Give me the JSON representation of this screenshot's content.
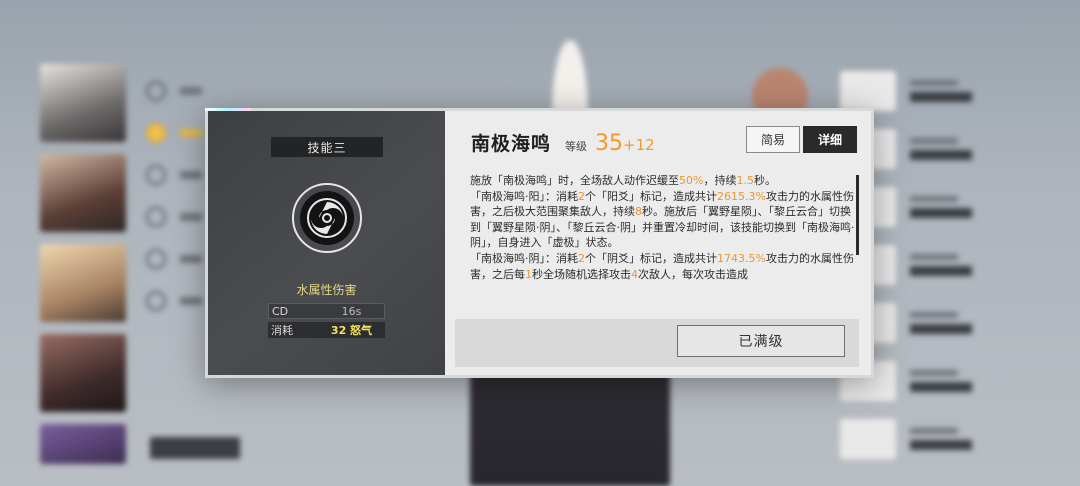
{
  "dialog": {
    "skill_slot": "技能三",
    "skill_icon": "water-swirl-icon",
    "element_type": "水属性伤害",
    "stats": {
      "cd_label": "CD",
      "cd_value": "16s",
      "cost_label": "消耗",
      "cost_value": "32 怒气"
    },
    "skill_name": "南极海鸣",
    "level_label": "等级",
    "level_value": "35",
    "level_bonus": "+12",
    "mode_simple": "简易",
    "mode_detail": "详细",
    "description": {
      "p1": [
        {
          "t": "施放「南极海鸣」时，全场敌人动作迟缓至"
        },
        {
          "t": "50%",
          "h": true
        },
        {
          "t": "，持续"
        },
        {
          "t": "1.5",
          "h": true
        },
        {
          "t": "秒。"
        }
      ],
      "p2": [
        {
          "t": "「南极海鸣·阳」：消耗"
        },
        {
          "t": "2",
          "h": true
        },
        {
          "t": "个「阳爻」标记，造成共计"
        },
        {
          "t": "2615.3%",
          "h": true
        },
        {
          "t": "攻击力的水属性伤害，之后极大范围聚集敌人，持续"
        },
        {
          "t": "8",
          "h": true
        },
        {
          "t": "秒。施放后「翼野星陨」、「黎丘云合」切换到「翼野星陨·阴」、「黎丘云合·阴」并重置冷却时间，该技能切换到「南极海鸣·阴」，自身进入「虚极」状态。"
        }
      ],
      "p3": [
        {
          "t": "「南极海鸣·阴」：消耗"
        },
        {
          "t": "2",
          "h": true
        },
        {
          "t": "个「阴爻」标记，造成共计"
        },
        {
          "t": "1743.5%",
          "h": true
        },
        {
          "t": "攻击力的水属性伤害，之后每"
        },
        {
          "t": "1",
          "h": true
        },
        {
          "t": "秒全场随机选择攻击"
        },
        {
          "t": "4",
          "h": true
        },
        {
          "t": "次敌人，每次攻击造成"
        }
      ]
    },
    "maxed_label": "已满级"
  },
  "colors": {
    "highlight": "#ef9630",
    "element_text": "#e3d68a",
    "cost_text": "#f6e25a"
  }
}
